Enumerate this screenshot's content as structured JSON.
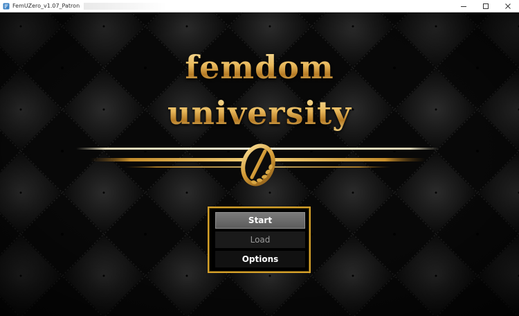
{
  "window": {
    "title": "FemUZero_v1.07_Patron",
    "controls": {
      "minimize": "minimize-icon",
      "maximize": "maximize-icon",
      "close": "close-icon"
    }
  },
  "logo": {
    "line1": "femdom",
    "line2": "university",
    "emblem": "oval-ring-emblem-with-laurel",
    "color": "#e8b85b"
  },
  "menu": {
    "items": [
      {
        "label": "Start",
        "state": "selected"
      },
      {
        "label": "Load",
        "state": "disabled"
      },
      {
        "label": "Options",
        "state": "normal"
      }
    ],
    "frame_color": "#d4a02a"
  },
  "background": {
    "pattern": "tufted-quilted-diamond",
    "color": "#0b0b0b"
  }
}
